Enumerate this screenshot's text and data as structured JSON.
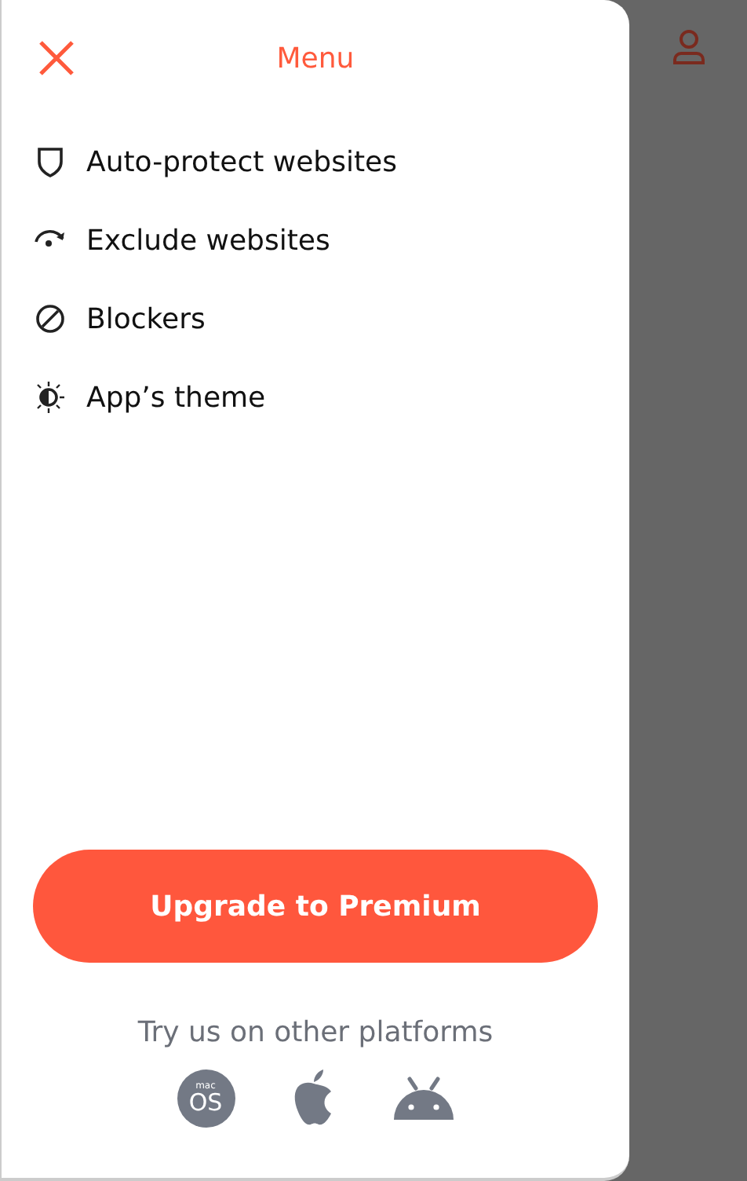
{
  "header": {
    "title": "Menu"
  },
  "menu": [
    {
      "kind": "shield",
      "label": "Auto-protect websites"
    },
    {
      "kind": "exclude",
      "label": "Exclude websites"
    },
    {
      "kind": "block",
      "label": "Blockers"
    },
    {
      "kind": "theme",
      "label": "App’s theme"
    }
  ],
  "upgrade_button": "Upgrade to Premium",
  "platforms": {
    "caption": "Try us on other platforms",
    "items": [
      {
        "kind": "macos",
        "top": "mac",
        "text": "OS"
      },
      {
        "kind": "apple"
      },
      {
        "kind": "android"
      }
    ]
  }
}
